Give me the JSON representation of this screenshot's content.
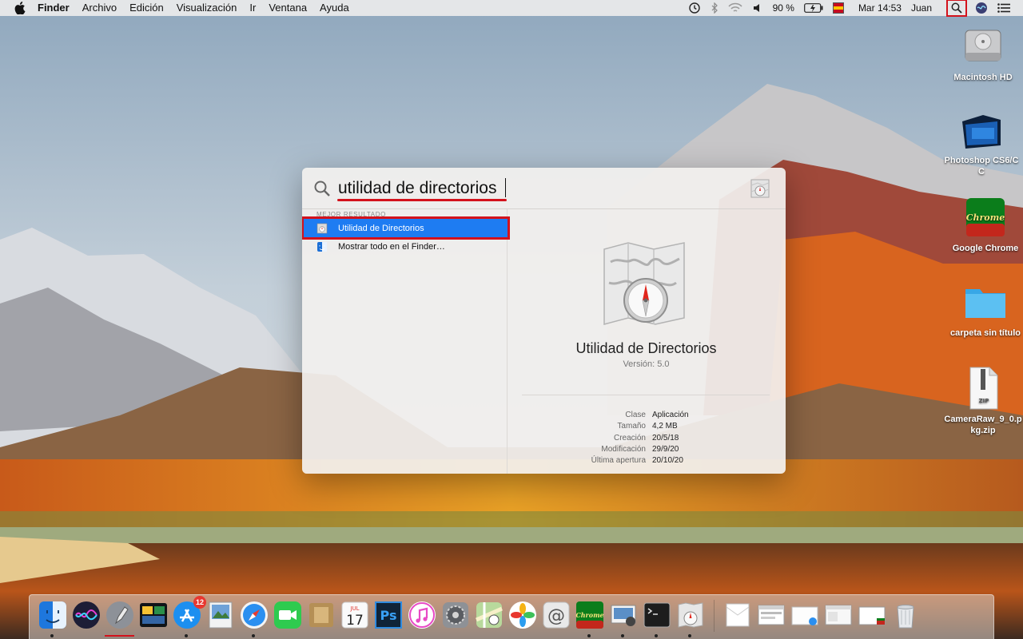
{
  "menubar": {
    "app_name": "Finder",
    "items": [
      "Archivo",
      "Edición",
      "Visualización",
      "Ir",
      "Ventana",
      "Ayuda"
    ],
    "battery": "90 %",
    "clock": "Mar 14:53",
    "user": "Juan",
    "status_icons": [
      "time-machine-icon",
      "bluetooth-icon",
      "wifi-icon",
      "volume-icon",
      "battery-icon",
      "input-source-flag-icon",
      "spotlight-icon",
      "siri-icon",
      "notification-center-icon"
    ]
  },
  "desktop_icons": [
    {
      "label": "Macintosh HD",
      "icon": "hard-drive-icon"
    },
    {
      "label": "Photoshop CS6/CC",
      "icon": "photoshop-folder-icon"
    },
    {
      "label": "Google Chrome",
      "icon": "chrome-icon",
      "badge_text": "Chrome"
    },
    {
      "label": "carpeta sin título",
      "icon": "folder-icon"
    },
    {
      "label": "CameraRaw_9_0.pkg.zip",
      "icon": "zip-file-icon",
      "badge_text": "ZIP"
    }
  ],
  "spotlight": {
    "query": "utilidad de directorios",
    "section_label": "MEJOR RESULTADO",
    "results": [
      {
        "label": "Utilidad de Directorios",
        "icon": "directory-utility-icon",
        "selected": true
      },
      {
        "label": "Mostrar todo en el Finder…",
        "icon": "finder-icon",
        "selected": false
      }
    ],
    "preview": {
      "name": "Utilidad de Directorios",
      "version": "Versión: 5.0",
      "metadata": [
        {
          "key": "Clase",
          "value": "Aplicación"
        },
        {
          "key": "Tamaño",
          "value": "4,2 MB"
        },
        {
          "key": "Creación",
          "value": "20/5/18"
        },
        {
          "key": "Modificación",
          "value": "29/9/20"
        },
        {
          "key": "Última apertura",
          "value": "20/10/20"
        }
      ]
    }
  },
  "dock": {
    "calendar_month": "JUL",
    "calendar_day": "17",
    "app_store_badge": "12",
    "photoshop_label": "Ps",
    "chrome_label": "Chrome",
    "items": [
      "finder-icon",
      "siri-icon",
      "launchpad-icon",
      "screens-icon",
      "app-store-icon",
      "preview-icon",
      "safari-icon",
      "facetime-icon",
      "notefile-icon",
      "calendar-icon",
      "photoshop-icon",
      "itunes-icon",
      "system-preferences-icon",
      "maps-icon",
      "photos-icon",
      "mail-icon",
      "chrome-icon",
      "image-capture-icon",
      "terminal-icon",
      "directory-utility-icon",
      "document-icon",
      "browser-window-icon",
      "document-icon",
      "window-icon",
      "window-icon",
      "trash-icon"
    ]
  },
  "colors": {
    "highlight_red": "#d3121c",
    "selection_blue": "#1e7cf2"
  }
}
